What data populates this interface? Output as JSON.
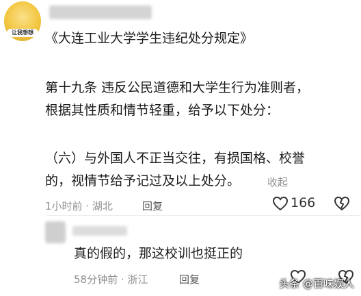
{
  "post": {
    "avatar_badge": "让我想想",
    "title_line": "《大连工业大学学生违纪处分规定》",
    "article_line1": "第十九条  违反公民道德和大学生行为准则者，",
    "article_line2": "根据其性质和情节轻重，给予以下处分：",
    "clause_line1": "（六）与外国人不正当交往，有损国格、校誉",
    "clause_line2": "的，视情节给予记过及以上处分。",
    "collapse_label": "收起",
    "time_location": "1小时前 · 湖北",
    "reply_label": "回复",
    "like_count": "166"
  },
  "reply": {
    "text": "真的假的，那这校训也挺正的",
    "time_location": "58分钟前 · 浙江",
    "reply_label": "回复"
  },
  "watermark": "头条 @百味娱人"
}
